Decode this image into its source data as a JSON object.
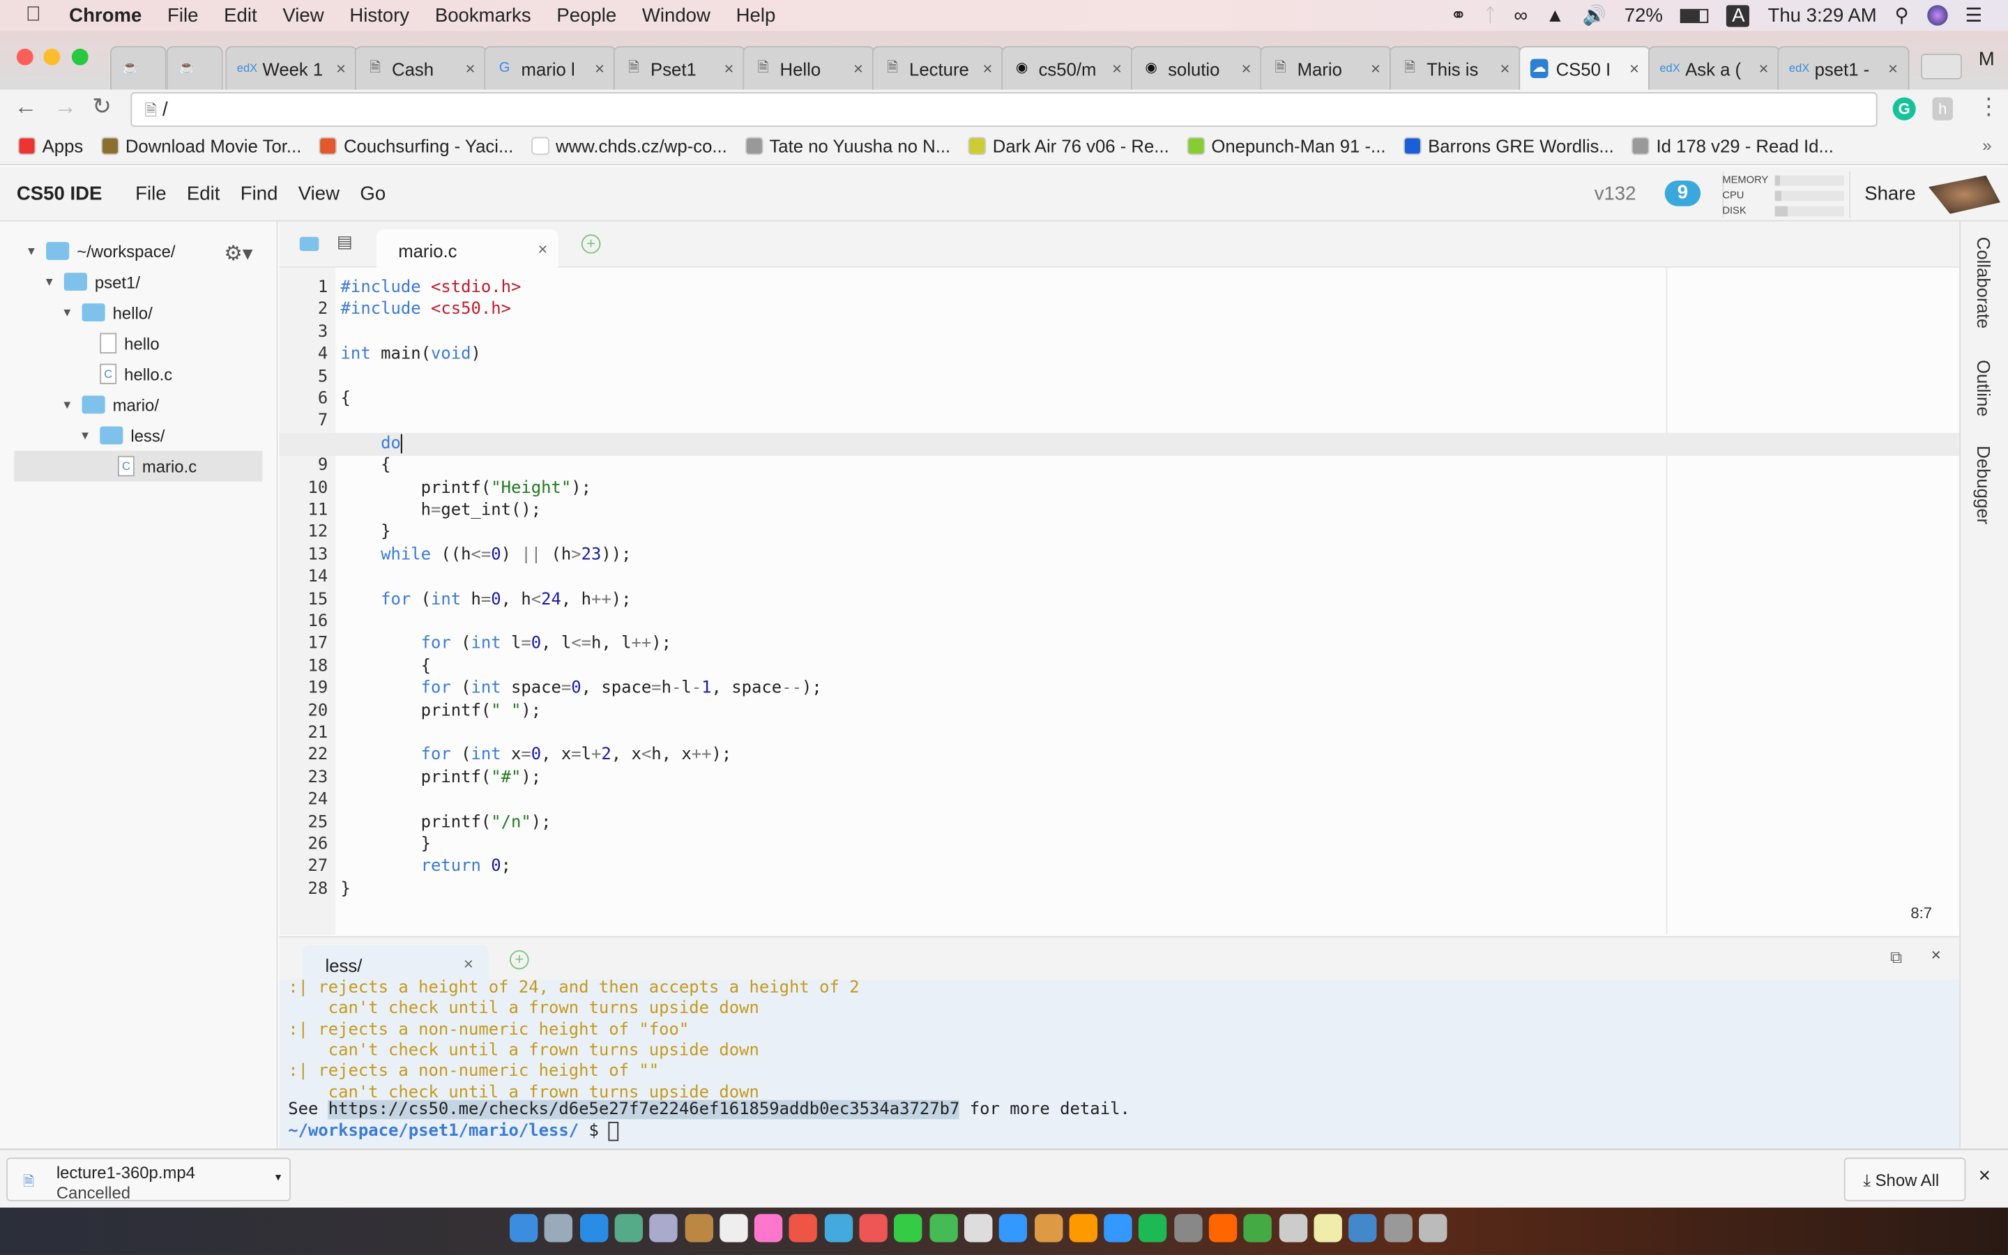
{
  "menubar": {
    "app": "Chrome",
    "items": [
      "File",
      "Edit",
      "View",
      "History",
      "Bookmarks",
      "People",
      "Window",
      "Help"
    ],
    "battery": "72%",
    "input_source": "A",
    "clock": "Thu 3:29 AM"
  },
  "tabs": [
    {
      "label": "",
      "icon": "java-icon"
    },
    {
      "label": "",
      "icon": "java-icon"
    },
    {
      "label": "Week 1",
      "icon": "edx-icon"
    },
    {
      "label": "Cash",
      "icon": "page-icon"
    },
    {
      "label": "mario l",
      "icon": "google-icon"
    },
    {
      "label": "Pset1",
      "icon": "page-icon"
    },
    {
      "label": "Hello",
      "icon": "page-icon"
    },
    {
      "label": "Lecture",
      "icon": "page-icon"
    },
    {
      "label": "cs50/m",
      "icon": "github-icon"
    },
    {
      "label": "solutio",
      "icon": "github-icon"
    },
    {
      "label": "Mario",
      "icon": "page-icon"
    },
    {
      "label": "This is",
      "icon": "page-icon"
    },
    {
      "label": "CS50 I",
      "icon": "cs50-icon",
      "active": true
    },
    {
      "label": "Ask a (",
      "icon": "edx-icon"
    },
    {
      "label": "pset1 -",
      "icon": "edx-icon"
    }
  ],
  "profile_initial": "M",
  "address": {
    "value": "/"
  },
  "bookmarks": [
    "Apps",
    "Download Movie Tor...",
    "Couchsurfing - Yaci...",
    "www.chds.cz/wp-co...",
    "Tate no Yuusha no N...",
    "Dark Air 76 v06 - Re...",
    "Onepunch-Man 91 -...",
    "Barrons GRE Wordlis...",
    "Id 178 v29 - Read Id..."
  ],
  "ide": {
    "brand": "CS50 IDE",
    "menu": [
      "File",
      "Edit",
      "Find",
      "View",
      "Go"
    ],
    "version": "v132",
    "cloud_badge": "9",
    "stats": [
      {
        "label": "MEMORY",
        "value": 0.08
      },
      {
        "label": "CPU",
        "value": 0.1
      },
      {
        "label": "DISK",
        "value": 0.18
      }
    ],
    "share": "Share"
  },
  "tree": [
    {
      "label": "~/workspace/",
      "type": "folder",
      "depth": 0,
      "open": true
    },
    {
      "label": "pset1/",
      "type": "folder",
      "depth": 1,
      "open": true
    },
    {
      "label": "hello/",
      "type": "folder",
      "depth": 2,
      "open": true
    },
    {
      "label": "hello",
      "type": "file",
      "depth": 3
    },
    {
      "label": "hello.c",
      "type": "cfile",
      "depth": 3
    },
    {
      "label": "mario/",
      "type": "folder",
      "depth": 2,
      "open": true
    },
    {
      "label": "less/",
      "type": "folder",
      "depth": 3,
      "open": true
    },
    {
      "label": "mario.c",
      "type": "cfile",
      "depth": 4,
      "selected": true
    }
  ],
  "editor": {
    "tab": "mario.c",
    "cursor": "8:7",
    "active_line": 8,
    "lines": [
      "#include <stdio.h>",
      "#include <cs50.h>",
      "",
      "int main(void)",
      "",
      "{",
      "",
      "    do",
      "    {",
      "        printf(\"Height\");",
      "        h=get_int();",
      "    }",
      "    while ((h<=0) || (h>23));",
      "",
      "    for (int h=0, h<24, h++);",
      "",
      "        for (int l=0, l<=h, l++);",
      "        {",
      "        for (int space=0, space=h-l-1, space--);",
      "        printf(\" \");",
      "",
      "        for (int x=0, x=l+2, x<h, x++);",
      "        printf(\"#\");",
      "",
      "        printf(\"/n\");",
      "        }",
      "        return 0;",
      "}"
    ]
  },
  "right_panel": [
    "Collaborate",
    "Outline",
    "Debugger"
  ],
  "terminal": {
    "tab": "less/",
    "lines": [
      {
        "t": ":| rejects a height of 24, and then accepts a height of 2",
        "c": "warn"
      },
      {
        "t": "    can't check until a frown turns upside down",
        "c": "warn"
      },
      {
        "t": ":| rejects a non-numeric height of \"foo\"",
        "c": "warn"
      },
      {
        "t": "    can't check until a frown turns upside down",
        "c": "warn"
      },
      {
        "t": ":| rejects a non-numeric height of \"\"",
        "c": "warn"
      },
      {
        "t": "    can't check until a frown turns upside down",
        "c": "warn"
      }
    ],
    "see": "See ",
    "link": "https://cs50.me/checks/d6e5e27f7e2246ef161859addb0ec3534a3727b7",
    "detail": " for more detail.",
    "prompt": "~/workspace/pset1/mario/less/",
    "dollar": " $ "
  },
  "download": {
    "file": "lecture1-360p.mp4",
    "status": "Cancelled",
    "show_all": "Show All"
  },
  "colors": {
    "accent": "#3a7bd5",
    "warn": "#c49a1d",
    "string": "#1f7a1f",
    "include": "#c21b2b",
    "folder": "#7ec1ea"
  }
}
